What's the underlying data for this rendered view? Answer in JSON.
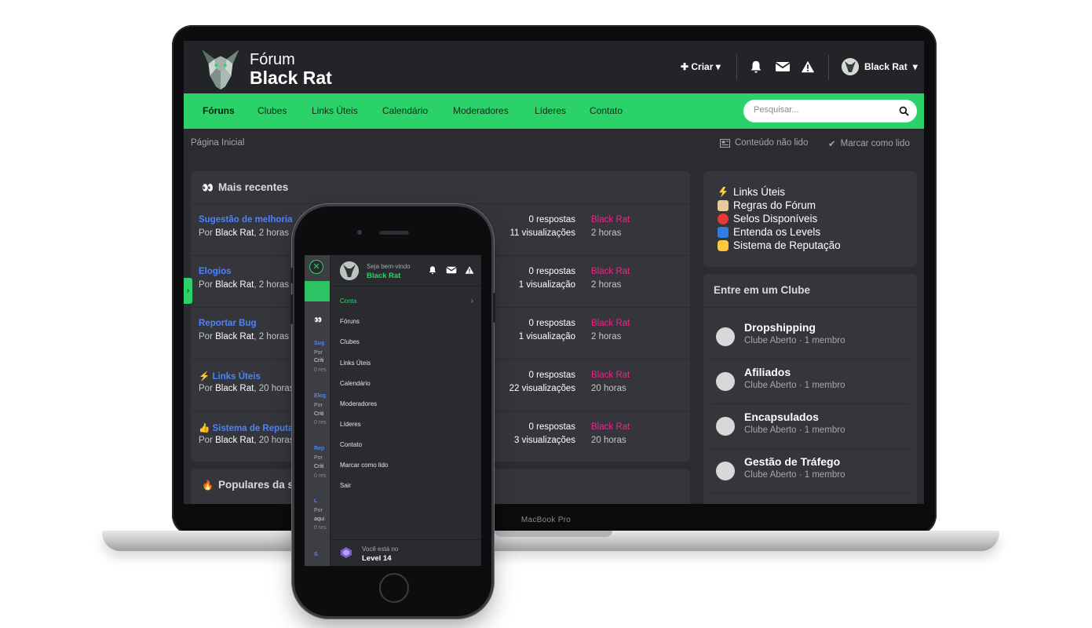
{
  "laptop": {
    "brand": "MacBook Pro"
  },
  "header": {
    "logo_line1": "Fórum",
    "logo_line2": "Black Rat",
    "create_label": "Criar",
    "username": "Black Rat"
  },
  "nav": {
    "items": [
      "Fóruns",
      "Clubes",
      "Links Úteis",
      "Calendário",
      "Moderadores",
      "Líderes",
      "Contato"
    ],
    "active": "Fóruns",
    "search_placeholder": "Pesquisar..."
  },
  "breadcrumb": {
    "home": "Página Inicial",
    "unread": "Conteúdo não lido",
    "mark_read": "Marcar como lido"
  },
  "recent": {
    "title": "Mais recentes",
    "topics": [
      {
        "title": "Sugestão de melhoria",
        "meta_prefix": "Por ",
        "author": "Black Rat",
        "meta_suffix": ", 2 horas",
        "replies": "0 respostas",
        "views": "11 visualizações",
        "last_user": "Black Rat",
        "last_time": "2 horas"
      },
      {
        "title": "Elogios",
        "meta_prefix": "Por ",
        "author": "Black Rat",
        "meta_suffix": ", 2 horas",
        "replies": "0 respostas",
        "views": "1 visualização",
        "last_user": "Black Rat",
        "last_time": "2 horas"
      },
      {
        "title": "Reportar Bug",
        "meta_prefix": "Por ",
        "author": "Black Rat",
        "meta_suffix": ", 2 horas",
        "replies": "0 respostas",
        "views": "1 visualização",
        "last_user": "Black Rat",
        "last_time": "2 horas"
      },
      {
        "title": "Links Úteis",
        "meta_prefix": "Por ",
        "author": "Black Rat",
        "meta_suffix": ", 20 horas",
        "replies": "0 respostas",
        "views": "22 visualizações",
        "last_user": "Black Rat",
        "last_time": "20 horas"
      },
      {
        "title": "Sistema de Reputa",
        "meta_prefix": "Por ",
        "author": "Black Rat",
        "meta_suffix": ", 20 horas",
        "replies": "0 respostas",
        "views": "3 visualizações",
        "last_user": "Black Rat",
        "last_time": "20 horas"
      }
    ]
  },
  "popular": {
    "title": "Populares da s"
  },
  "sidebar_links": {
    "items": [
      "Links Úteis",
      "Regras do Fórum",
      "Selos Disponíveis",
      "Entenda os Levels",
      "Sistema de Reputação"
    ]
  },
  "clubs": {
    "title": "Entre em um Clube",
    "items": [
      {
        "name": "Dropshipping",
        "type": "Clube Aberto",
        "members": "1 membro"
      },
      {
        "name": "Afiliados",
        "type": "Clube Aberto",
        "members": "1 membro"
      },
      {
        "name": "Encapsulados",
        "type": "Clube Aberto",
        "members": "1 membro"
      },
      {
        "name": "Gestão de Tráfego",
        "type": "Clube Aberto",
        "members": "1 membro"
      }
    ]
  },
  "phone": {
    "welcome": "Seja bem-vindo",
    "username": "Black Rat",
    "menu": [
      "Conta",
      "Fóruns",
      "Clubes",
      "Links Úteis",
      "Calendário",
      "Moderadores",
      "Líderes",
      "Contato",
      "Marcar como lido",
      "Sair"
    ],
    "level_prefix": "Você está no",
    "level": "Level 14",
    "bg_strip": [
      {
        "text": "Sug",
        "color": "#4b83ff"
      },
      {
        "text": "Por",
        "color": "#aeb0b4"
      },
      {
        "text": "Criti",
        "color": "#d9dadd"
      },
      {
        "text": "0 res",
        "color": "#8a8c90"
      },
      {
        "text": "Elog",
        "color": "#4b83ff"
      },
      {
        "text": "Por",
        "color": "#aeb0b4"
      },
      {
        "text": "Criti",
        "color": "#d9dadd"
      },
      {
        "text": "0 res",
        "color": "#8a8c90"
      },
      {
        "text": "Rep",
        "color": "#4b83ff"
      },
      {
        "text": "Por",
        "color": "#aeb0b4"
      },
      {
        "text": "Criti",
        "color": "#d9dadd"
      },
      {
        "text": "0 res",
        "color": "#8a8c90"
      },
      {
        "text": "L",
        "color": "#4b83ff"
      },
      {
        "text": "Por",
        "color": "#aeb0b4"
      },
      {
        "text": "aqui",
        "color": "#d9dadd"
      },
      {
        "text": "0 res",
        "color": "#8a8c90"
      },
      {
        "text": "S",
        "color": "#4b83ff"
      }
    ]
  },
  "colors": {
    "accent": "#2ad269",
    "link": "#4b83ff",
    "username": "#e8278b",
    "bg": "#2b2c30",
    "card": "#35363b"
  }
}
